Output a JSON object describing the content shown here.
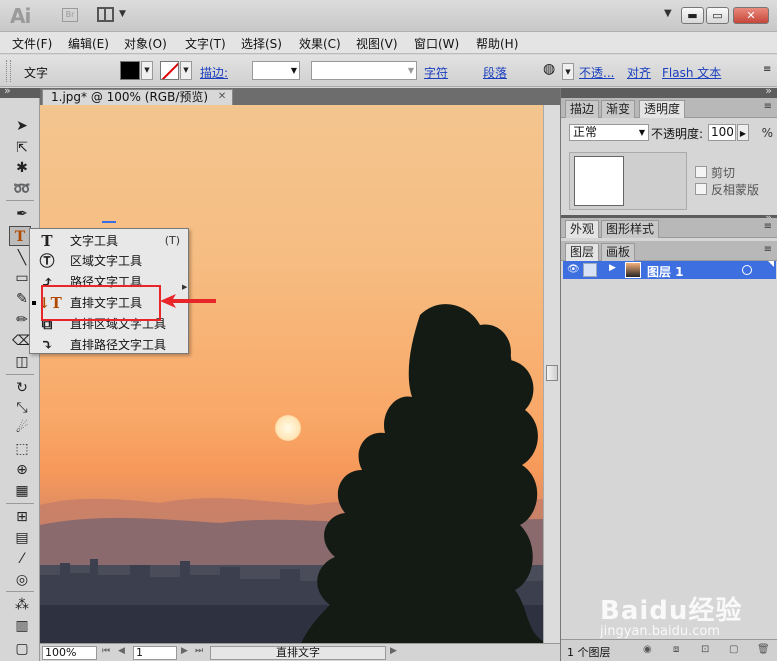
{
  "app": {
    "logo": "Ai",
    "bridge": "Br"
  },
  "window": {
    "minimize": "▬",
    "restore": "▭",
    "close": "✕"
  },
  "menu": [
    "文件(F)",
    "编辑(E)",
    "对象(O)",
    "文字(T)",
    "选择(S)",
    "效果(C)",
    "视图(V)",
    "窗口(W)",
    "帮助(H)"
  ],
  "control": {
    "tool_name": "文字",
    "stroke_label": "描边:",
    "char_link": "字符",
    "para_link": "段落",
    "opacity_link": "不透...",
    "align_link": "对齐",
    "flash_link": "Flash 文本"
  },
  "document": {
    "tab_title": "1.jpg* @ 100% (RGB/预览)"
  },
  "flyout": {
    "items": [
      {
        "icon": "T",
        "label": "文字工具",
        "shortcut": "(T)"
      },
      {
        "icon": "Ⓣ",
        "label": "区域文字工具",
        "shortcut": ""
      },
      {
        "icon": "⤴",
        "label": "路径文字工具",
        "shortcut": ""
      },
      {
        "icon": "↓T",
        "label": "直排文字工具",
        "shortcut": ""
      },
      {
        "icon": "⧉",
        "label": "直排区域文字工具",
        "shortcut": ""
      },
      {
        "icon": "⤵",
        "label": "直排路径文字工具",
        "shortcut": ""
      }
    ]
  },
  "statusbar": {
    "zoom": "100%",
    "page": "1",
    "status": "直排文字"
  },
  "panels": {
    "top_tabs": [
      "描边",
      "渐变",
      "透明度"
    ],
    "blend_mode": "正常",
    "opacity_label": "不透明度:",
    "opacity_value": "100",
    "clip_label": "剪切",
    "invert_label": "反相蒙版",
    "mid_tabs": [
      "外观",
      "图形样式"
    ],
    "layer_tabs": [
      "图层",
      "画板"
    ],
    "layer_name": "图层 1",
    "layer_count": "1 个图层"
  },
  "watermark": {
    "main": "Baidu经验",
    "sub": "jingyan.baidu.com"
  },
  "colors": {
    "highlight": "#e8262a",
    "selection": "#3d6fe0",
    "link": "#1a3fbf"
  }
}
